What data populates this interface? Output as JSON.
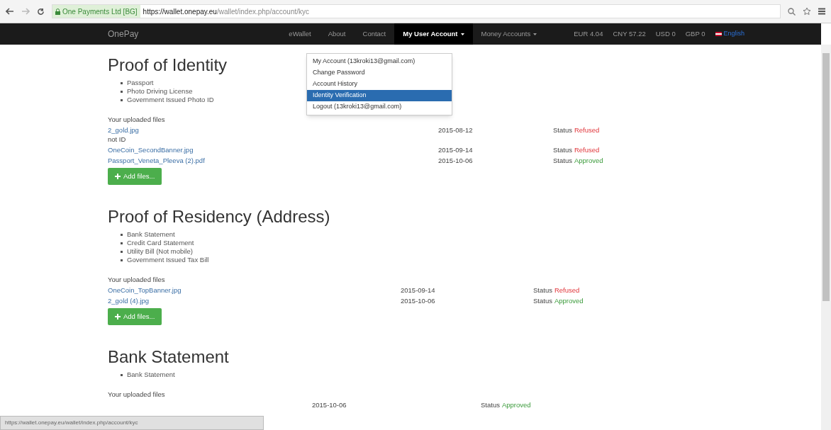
{
  "browser": {
    "site_identity": "One Payments Ltd [BG]",
    "url_host": "https://wallet.onepay.eu",
    "url_path": "/wallet/index.php/account/kyc",
    "status_url": "https://wallet.onepay.eu/wallet/index.php/account/kyc"
  },
  "navbar": {
    "brand": "OnePay",
    "links": [
      {
        "label": "eWallet",
        "selected": false,
        "dropdown": false
      },
      {
        "label": "About",
        "selected": false,
        "dropdown": false
      },
      {
        "label": "Contact",
        "selected": false,
        "dropdown": false
      },
      {
        "label": "My User Account",
        "selected": true,
        "dropdown": true
      },
      {
        "label": "Money Accounts",
        "selected": false,
        "dropdown": true
      }
    ],
    "balances": [
      "EUR 4.04",
      "CNY 57.22",
      "USD 0",
      "GBP 0"
    ],
    "language": "English"
  },
  "dropdown_menu": [
    {
      "label": "My Account (13kroki13@gmail.com)",
      "selected": false
    },
    {
      "label": "Change Password",
      "selected": false
    },
    {
      "label": "Account History",
      "selected": false
    },
    {
      "label": "Identity Verification",
      "selected": true
    },
    {
      "label": "Logout (13kroki13@gmail.com)",
      "selected": false
    }
  ],
  "sections": [
    {
      "title": "Proof of Identity",
      "documents": [
        "Passport",
        "Photo Driving License",
        "Government Issued Photo ID"
      ],
      "uploaded_label": "Your uploaded files",
      "files": [
        {
          "name": "2_gold.jpg",
          "note": "not ID",
          "date": "2015-08-12",
          "status_label": "Status",
          "status": "Refused",
          "kind": "refused"
        },
        {
          "name": "OneCoin_SecondBanner.jpg",
          "date": "2015-09-14",
          "status_label": "Status",
          "status": "Refused",
          "kind": "refused"
        },
        {
          "name": "Passport_Veneta_Pleeva (2).pdf",
          "date": "2015-10-06",
          "status_label": "Status",
          "status": "Approved",
          "kind": "approved"
        }
      ],
      "add_button": "Add files..."
    },
    {
      "title": "Proof of Residency (Address)",
      "documents": [
        "Bank Statement",
        "Credit Card Statement",
        "Utility Bill (Not mobile)",
        "Government Issued Tax Bill"
      ],
      "uploaded_label": "Your uploaded files",
      "files": [
        {
          "name": "OneCoin_TopBanner.jpg",
          "date": "2015-09-14",
          "status_label": "Status",
          "status": "Refused",
          "kind": "refused"
        },
        {
          "name": "2_gold (4).jpg",
          "date": "2015-10-06",
          "status_label": "Status",
          "status": "Approved",
          "kind": "approved"
        }
      ],
      "add_button": "Add files..."
    },
    {
      "title": "Bank Statement",
      "documents": [
        "Bank Statement"
      ],
      "uploaded_label": "Your uploaded files",
      "files": [
        {
          "date": "2015-10-06",
          "status_label": "Status",
          "status": "Approved",
          "kind": "approved"
        }
      ]
    }
  ]
}
